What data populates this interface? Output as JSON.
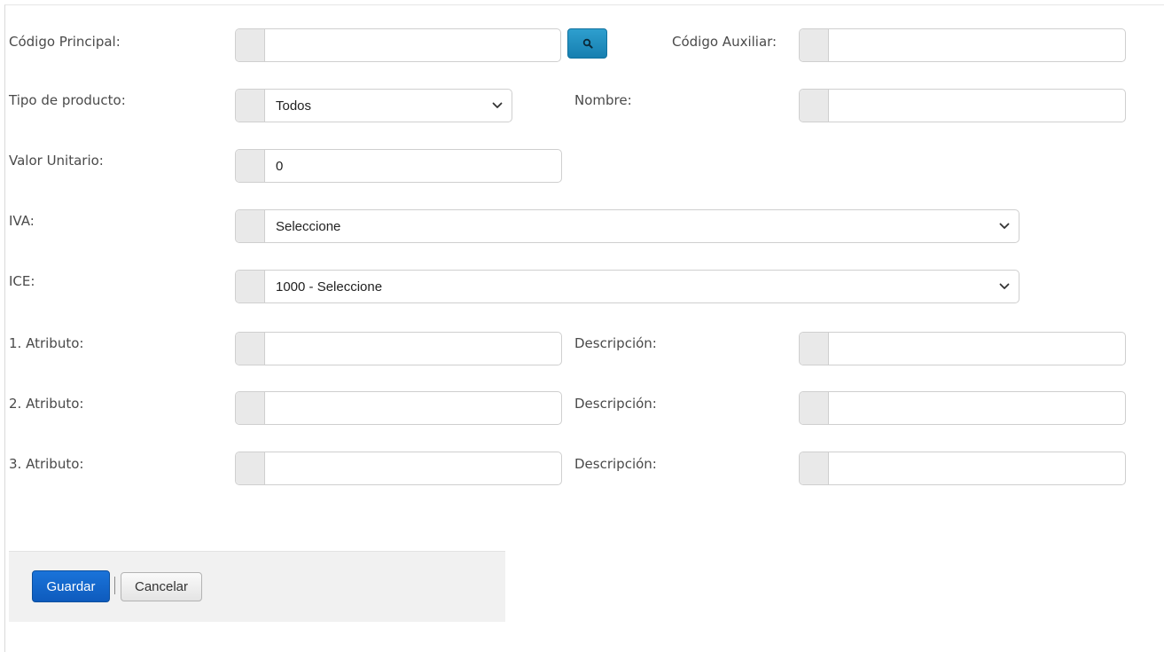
{
  "form": {
    "codigo_principal": {
      "label": "Código Principal:",
      "value": ""
    },
    "search_button": {
      "icon": "search-icon"
    },
    "codigo_auxiliar": {
      "label": "Código Auxiliar:",
      "value": ""
    },
    "tipo_producto": {
      "label": "Tipo de producto:",
      "value": "Todos"
    },
    "nombre": {
      "label": "Nombre:",
      "value": ""
    },
    "valor_unitario": {
      "label": "Valor Unitario:",
      "value": "0"
    },
    "iva": {
      "label": "IVA:",
      "value": "Seleccione"
    },
    "ice": {
      "label": "ICE:",
      "value": "1000 - Seleccione"
    },
    "atributos": [
      {
        "label": "1. Atributo:",
        "value": "",
        "desc_label": "Descripción:",
        "desc_value": ""
      },
      {
        "label": "2. Atributo:",
        "value": "",
        "desc_label": "Descripción:",
        "desc_value": ""
      },
      {
        "label": "3. Atributo:",
        "value": "",
        "desc_label": "Descripción:",
        "desc_value": ""
      }
    ]
  },
  "actions": {
    "save_label": "Guardar",
    "cancel_label": "Cancelar"
  },
  "colors": {
    "primary_button": "#1565c0",
    "search_button": "#1f8fc0",
    "addon": "#e9e9e9"
  }
}
